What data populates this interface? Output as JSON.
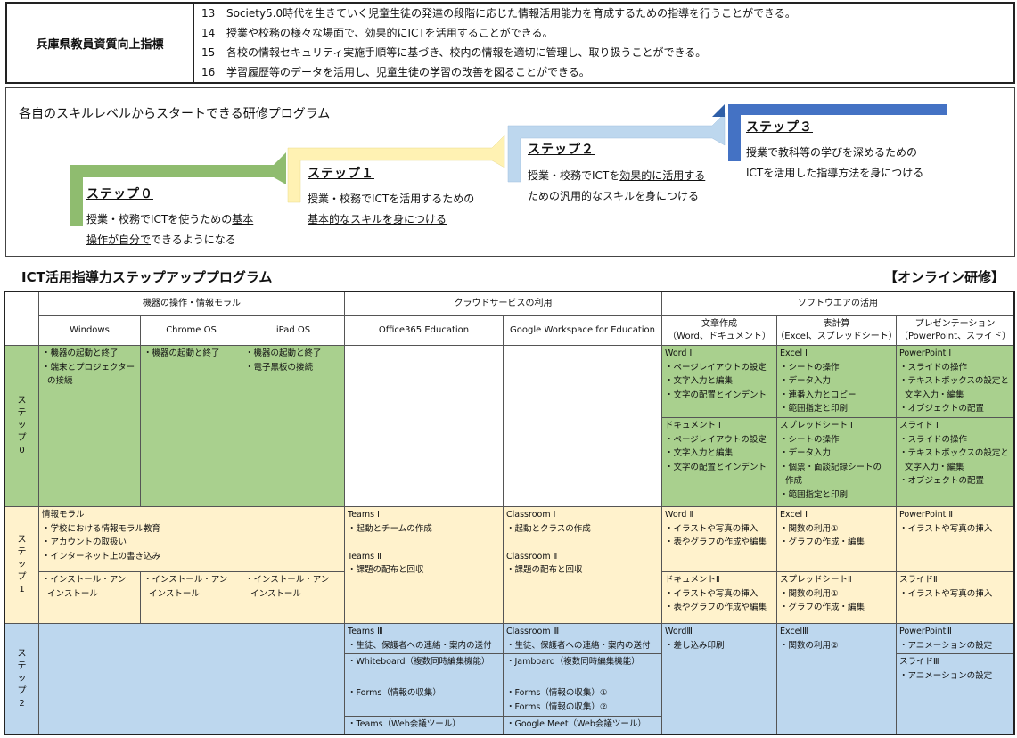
{
  "top": {
    "label": "兵庫県教員資質向上指標",
    "lines": [
      {
        "n": "13",
        "t": "Society5.0時代を生きていく児童生徒の発達の段階に応じた情報活用能力を育成するための指導を行うことができる。"
      },
      {
        "n": "14",
        "t": "授業や校務の様々な場面で、効果的にICTを活用することができる。"
      },
      {
        "n": "15",
        "t": "各校の情報セキュリティ実施手順等に基づき、校内の情報を適切に管理し、取り扱うことができる。"
      },
      {
        "n": "16",
        "t": "学習履歴等のデータを活用し、児童生徒の学習の改善を図ることができる。"
      }
    ]
  },
  "stairs": {
    "title": "各自のスキルレベルからスタートできる研修プログラム",
    "colors": {
      "s0": "#8fbc6f",
      "s1": "#fff2b3",
      "s2": "#bdd7ee",
      "s3": "#4472c4"
    },
    "s0": {
      "title": "ステップ０",
      "l1a": "授業・校務でICTを使うための",
      "l1b": "基本",
      "l2a": "操作が自分で",
      "l2b": "できる",
      "l2c": "ようになる"
    },
    "s1": {
      "title": "ステップ１",
      "l1": "授業・校務でICTを活用するための",
      "l2": "基本的なスキルを身につける"
    },
    "s2": {
      "title": "ステップ２",
      "l1a": "授業・校務でICTを",
      "l1b": "効果的に活用する",
      "l2": "ための汎用的なスキルを身につける"
    },
    "s3": {
      "title": "ステップ３",
      "l1": "授業で教科等の学びを深めるための",
      "l2": "ICTを活用した指導方法を身につける"
    }
  },
  "heading": "ICT活用指導力ステップアッププログラム",
  "heading_right": "【オンライン研修】",
  "grid": {
    "groups": [
      "機器の操作・情報モラル",
      "クラウドサービスの利用",
      "ソフトウエアの活用"
    ],
    "cols": [
      "Windows",
      "Chrome OS",
      "iPad OS",
      "Office365 Education",
      "Google Workspace for Education",
      "文章作成\n（Word、ドキュメント）",
      "表計算\n（Excel、スプレッドシート）",
      "プレゼンテーション\n（PowerPoint、スライド）"
    ],
    "rows": [
      "ス\nテ\nッ\nプ\n0",
      "ス\nテ\nッ\nプ\n1",
      "ス\nテ\nッ\nプ\n2"
    ],
    "s0": {
      "win": "・機器の起動と終了\n・端末とプロジェクター\n  の接続",
      "chrome": "・機器の起動と終了",
      "ipad": "・機器の起動と終了\n・電子黒板の接続",
      "word1": "Word I\n・ページレイアウトの設定\n・文字入力と編集\n・文字の配置とインデント",
      "excel1": "Excel I\n・シートの操作\n・データ入力\n・連番入力とコピー\n・範囲指定と印刷",
      "ppt1": "PowerPoint I\n・スライドの操作\n・テキストボックスの設定と\n  文字入力・編集\n・オブジェクトの配置",
      "doc1": "ドキュメント I\n・ページレイアウトの設定\n・文字入力と編集\n・文字の配置とインデント",
      "sheet1": "スプレッドシート I\n・シートの操作\n・データ入力\n・個票・面談記録シートの\n  作成\n・範囲指定と印刷",
      "slide1": "スライド I\n・スライドの操作\n・テキストボックスの設定と\n  文字入力・編集\n・オブジェクトの配置"
    },
    "s1": {
      "moral": "情報モラル\n・学校における情報モラル教育\n・アカウントの取扱い\n・インターネット上の書き込み",
      "inst": "・インストール・アン\n  インストール",
      "teams": "Teams Ⅰ\n・起動とチームの作成\n\nTeams Ⅱ\n・課題の配布と回収",
      "class": "Classroom Ⅰ\n・起動とクラスの作成\n\nClassroom Ⅱ\n・課題の配布と回収",
      "word2": "Word Ⅱ\n・イラストや写真の挿入\n・表やグラフの作成や編集",
      "excel2": "Excel Ⅱ\n・関数の利用①\n・グラフの作成・編集",
      "ppt2": "PowerPoint Ⅱ\n・イラストや写真の挿入",
      "doc2": "ドキュメントⅡ\n・イラストや写真の挿入\n・表やグラフの作成や編集",
      "sheet2": "スプレッドシートⅡ\n・関数の利用①\n・グラフの作成・編集",
      "slide2": "スライドⅡ\n・イラストや写真の挿入"
    },
    "s2": {
      "teams3a": "Teams Ⅲ\n・生徒、保護者への連絡・案内の送付",
      "teams3b": "・Whiteboard（複数同時編集機能）",
      "teams3c": "・Forms（情報の収集）",
      "teams3d": "・Teams（Web会議ツール）",
      "class3a": "Classroom Ⅲ\n・生徒、保護者への連絡・案内の送付",
      "class3b": "・Jamboard（複数同時編集機能）",
      "class3c": "・Forms（情報の収集）①\n・Forms（情報の収集）②",
      "class3d": "・Google Meet（Web会議ツール）",
      "word3": "WordⅢ\n・差し込み印刷",
      "excel3": "ExcelⅢ\n・関数の利用②",
      "ppt3": "PowerPointⅢ\n・アニメーションの設定",
      "slide3": "スライドⅢ\n・アニメーションの設定"
    }
  }
}
